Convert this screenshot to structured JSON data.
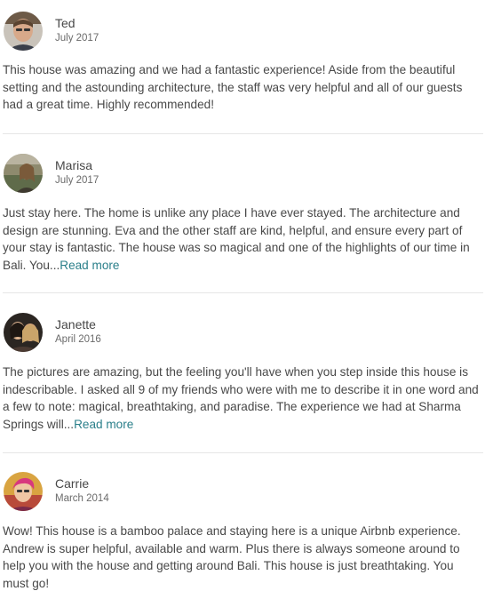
{
  "reviews": [
    {
      "name": "Ted",
      "date": "July 2017",
      "avatar_icon": "user-photo-ted",
      "text": "This house was amazing and we had a fantastic experience! Aside from the beautiful setting and the astounding architecture, the staff was very helpful and all of our guests had a great time. Highly recommended!",
      "read_more": ""
    },
    {
      "name": "Marisa",
      "date": "July 2017",
      "avatar_icon": "user-photo-marisa",
      "text": "Just stay here. The home is unlike any place I have ever stayed. The architecture and design are stunning. Eva and the other staff are kind, helpful, and ensure every part of your stay is fantastic. The house was so magical and one of the highlights of our time in Bali. You...",
      "read_more": "Read more"
    },
    {
      "name": "Janette",
      "date": "April 2016",
      "avatar_icon": "user-photo-janette",
      "text": "The pictures are amazing, but the feeling you'll have when you step inside this house is indescribable. I asked all 9 of my friends who were with me to describe it in one word and a few to note: magical, breathtaking, and paradise. The experience we had at Sharma Springs will...",
      "read_more": "Read more"
    },
    {
      "name": "Carrie",
      "date": "March 2014",
      "avatar_icon": "user-photo-carrie",
      "text": "Wow! This house is a bamboo palace and staying here is a unique Airbnb experience. Andrew is super helpful, available and warm. Plus there is always someone around to help you with the house and getting around Bali.  This house is just breathtaking. You must go!",
      "read_more": ""
    }
  ]
}
